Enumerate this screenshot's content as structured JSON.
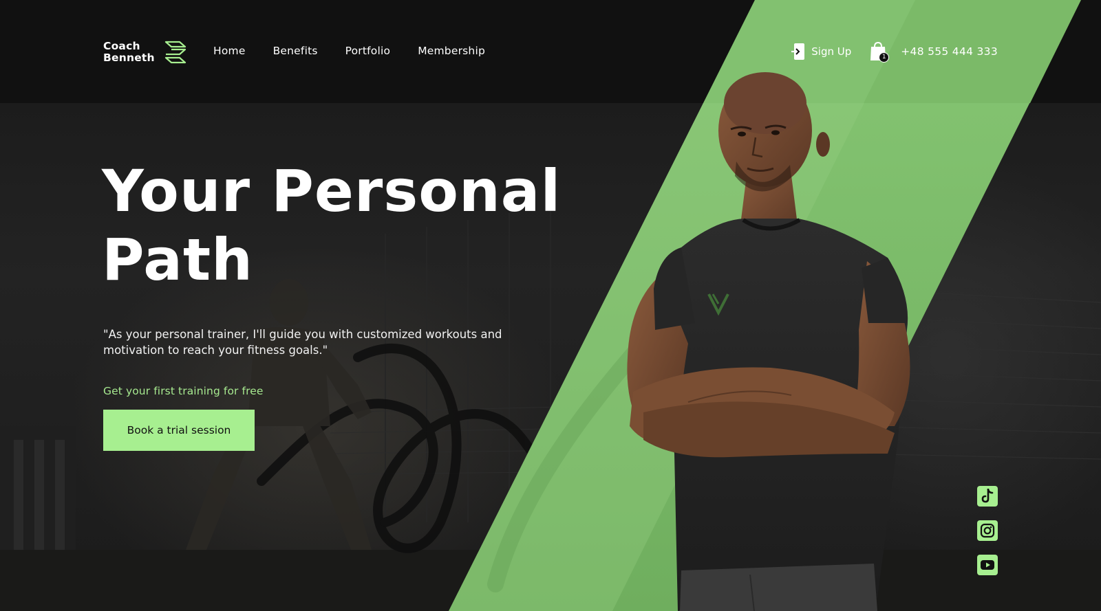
{
  "colors": {
    "accent": "#a7ef90",
    "accent_stripe": "#7dbf6a",
    "header_bg": "#111111",
    "text": "#ffffff"
  },
  "header": {
    "logo": {
      "line1": "Coach",
      "line2": "Benneth",
      "icon": "stacked-lines-logo-icon"
    },
    "nav": [
      {
        "label": "Home"
      },
      {
        "label": "Benefits"
      },
      {
        "label": "Portfolio"
      },
      {
        "label": "Membership"
      }
    ],
    "signup": {
      "label": "Sign Up",
      "icon": "sign-in-icon"
    },
    "cart": {
      "icon": "shopping-bag-icon",
      "count": "1"
    },
    "phone": "+48 555 444 333"
  },
  "hero": {
    "title_line1": "Your Personal",
    "title_line2": "Path",
    "quote": "\"As your personal trainer, I'll guide you with customized workouts and motivation to reach your fitness goals.\"",
    "promo": "Get your first training for free",
    "cta_label": "Book a trial session"
  },
  "social": [
    {
      "name": "tiktok",
      "icon": "tiktok-icon"
    },
    {
      "name": "instagram",
      "icon": "instagram-icon"
    },
    {
      "name": "youtube",
      "icon": "youtube-icon"
    }
  ]
}
